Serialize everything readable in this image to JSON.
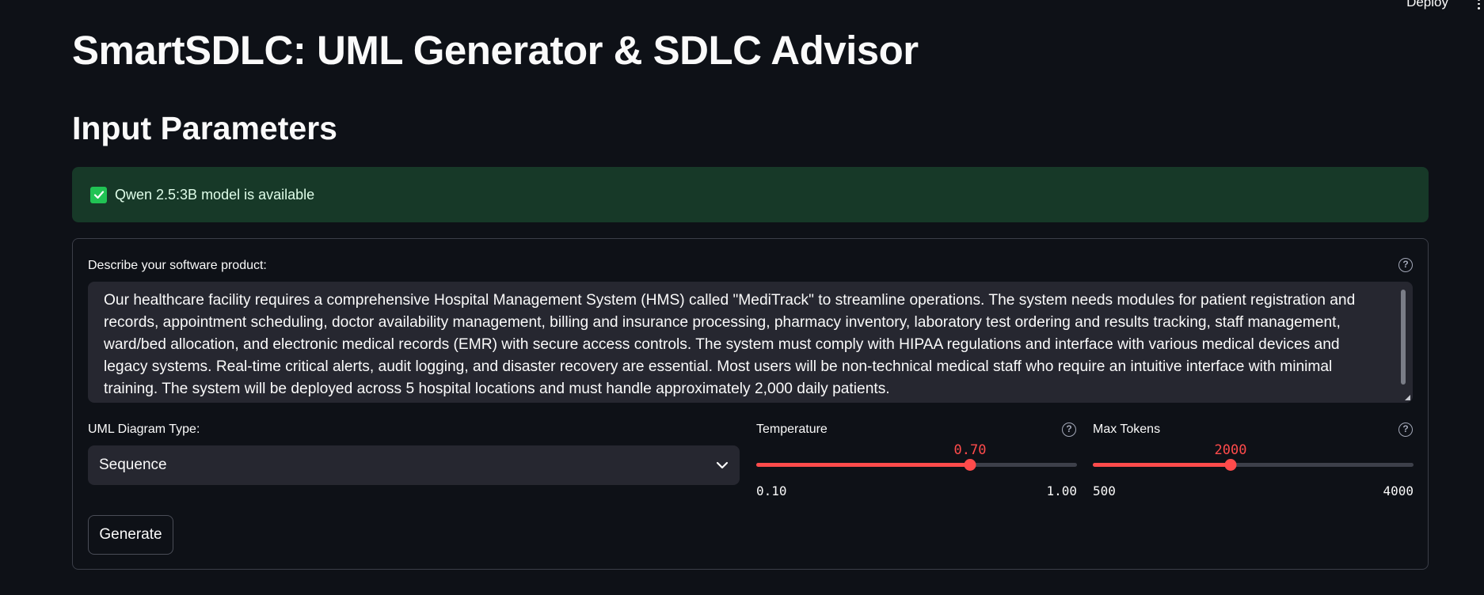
{
  "header": {
    "deploy_label": "Deploy"
  },
  "app_title": "SmartSDLC: UML Generator & SDLC Advisor",
  "section_title": "Input Parameters",
  "status": {
    "message": "Qwen 2.5:3B model is available",
    "color": "#21c354"
  },
  "description": {
    "label": "Describe your software product:",
    "value": "Our healthcare facility requires a comprehensive Hospital Management System (HMS) called \"MediTrack\" to streamline operations. The system needs modules for patient registration and records, appointment scheduling, doctor availability management, billing and insurance processing, pharmacy inventory, laboratory test ordering and results tracking, staff management, ward/bed allocation, and electronic medical records (EMR) with secure access controls. The system must comply with HIPAA regulations and interface with various medical devices and legacy systems. Real-time critical alerts, audit logging, and disaster recovery are essential. Most users will be non-technical medical staff who require an intuitive interface with minimal training. The system will be deployed across 5 hospital locations and must handle approximately 2,000 daily patients."
  },
  "diagram_type": {
    "label": "UML Diagram Type:",
    "selected": "Sequence"
  },
  "temperature": {
    "label": "Temperature",
    "value": "0.70",
    "min": "0.10",
    "max": "1.00",
    "fraction": 0.667
  },
  "max_tokens": {
    "label": "Max Tokens",
    "value": "2000",
    "min": "500",
    "max": "4000",
    "fraction": 0.429
  },
  "generate_label": "Generate",
  "accent_color": "#ff4b4b"
}
